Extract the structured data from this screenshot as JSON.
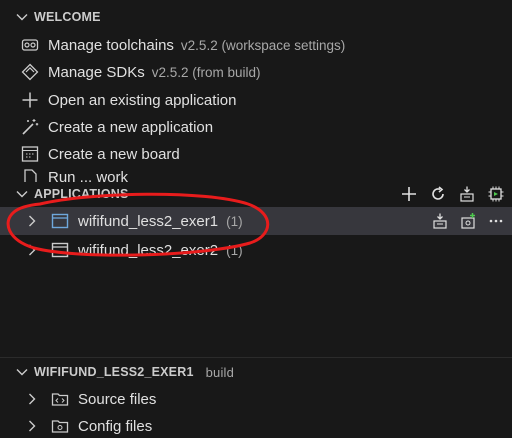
{
  "welcome": {
    "title": "WELCOME",
    "items": [
      {
        "label": "Manage toolchains",
        "desc": "v2.5.2 (workspace settings)",
        "icon": "toolchain-icon"
      },
      {
        "label": "Manage SDKs",
        "desc": "v2.5.2 (from build)",
        "icon": "sdk-icon"
      },
      {
        "label": "Open an existing application",
        "desc": "",
        "icon": "plus-icon"
      },
      {
        "label": "Create a new application",
        "desc": "",
        "icon": "magic-wand-icon"
      },
      {
        "label": "Create a new board",
        "desc": "",
        "icon": "board-icon"
      },
      {
        "label": "Run ... work",
        "desc": "",
        "icon": "file-icon"
      }
    ]
  },
  "applications": {
    "title": "APPLICATIONS",
    "actions": [
      "add-icon",
      "refresh-icon",
      "build-all-icon",
      "chip-icon"
    ],
    "items": [
      {
        "name": "wififund_less2_exer1",
        "count": "(1)",
        "selected": true
      },
      {
        "name": "wififund_less2_exer2",
        "count": "(1)",
        "selected": false
      }
    ]
  },
  "project": {
    "title": "WIFIFUND_LESS2_EXER1",
    "subtitle": "build",
    "items": [
      {
        "label": "Source files",
        "icon": "source-folder-icon"
      },
      {
        "label": "Config files",
        "icon": "config-folder-icon"
      }
    ]
  },
  "colors": {
    "background": "#181818",
    "selected": "#37373d",
    "annotation": "#e81c1c"
  }
}
